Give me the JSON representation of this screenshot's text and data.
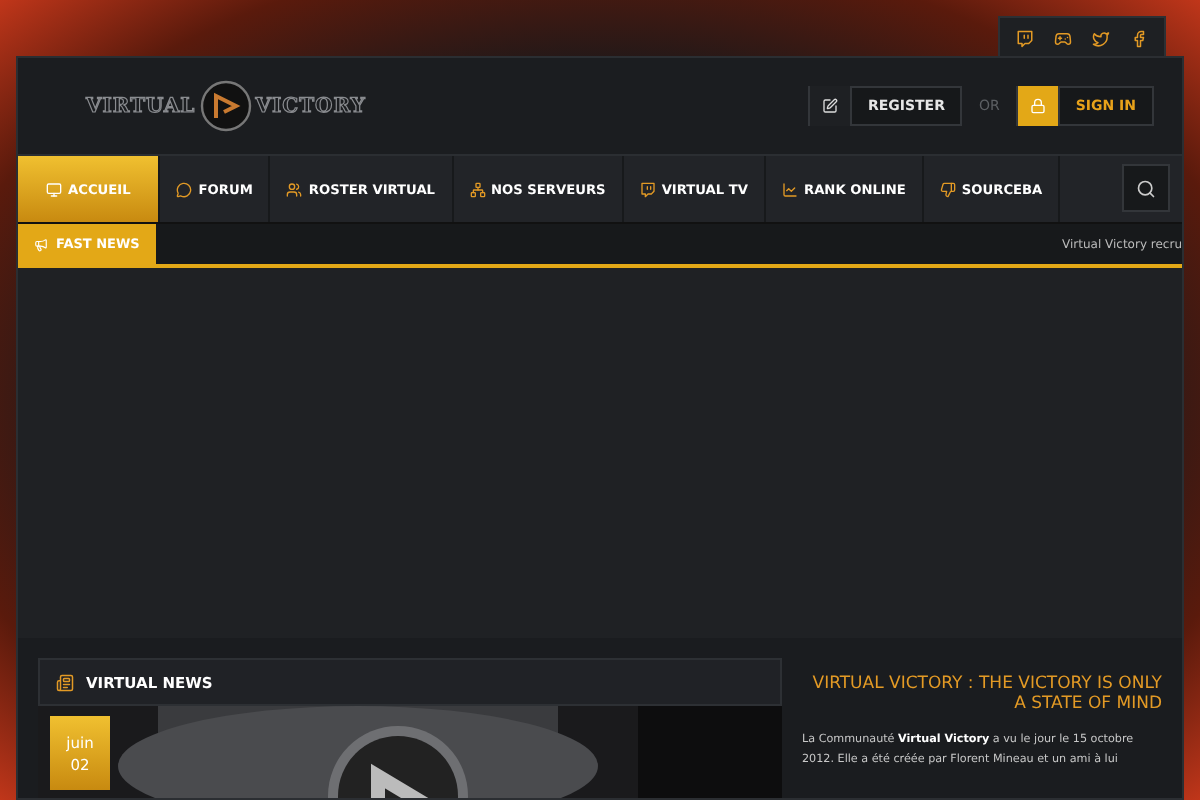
{
  "social": [
    {
      "kind": "twitch"
    },
    {
      "kind": "steam"
    },
    {
      "kind": "twitter"
    },
    {
      "kind": "facebook"
    }
  ],
  "logo": {
    "left": "VIRTUAL",
    "right": "VICTORY"
  },
  "account": {
    "register": "REGISTER",
    "or": "OR",
    "sign_in": "SIGN IN"
  },
  "nav": [
    {
      "label": "ACCUEIL",
      "selected": true
    },
    {
      "label": "FORUM",
      "selected": false
    },
    {
      "label": "ROSTER VIRTUAL",
      "selected": false
    },
    {
      "label": "NOS SERVEURS",
      "selected": false
    },
    {
      "label": "VIRTUAL TV",
      "selected": false
    },
    {
      "label": "RANK ONLINE",
      "selected": false
    },
    {
      "label": "SOURCEBA",
      "selected": false
    }
  ],
  "fast_news": {
    "label": "FAST NEWS",
    "ticker": "Virtual Victory recru"
  },
  "news": {
    "title": "VIRTUAL NEWS",
    "date_month": "juin",
    "date_day": "02"
  },
  "about": {
    "title": "VIRTUAL VICTORY : THE VICTORY IS ONLY A STATE OF MIND",
    "text": "La Communauté **Virtual Victory** a vu le jour le 15 octobre 2012. Elle a été créée par Florent Mineau et un ami à lui"
  }
}
